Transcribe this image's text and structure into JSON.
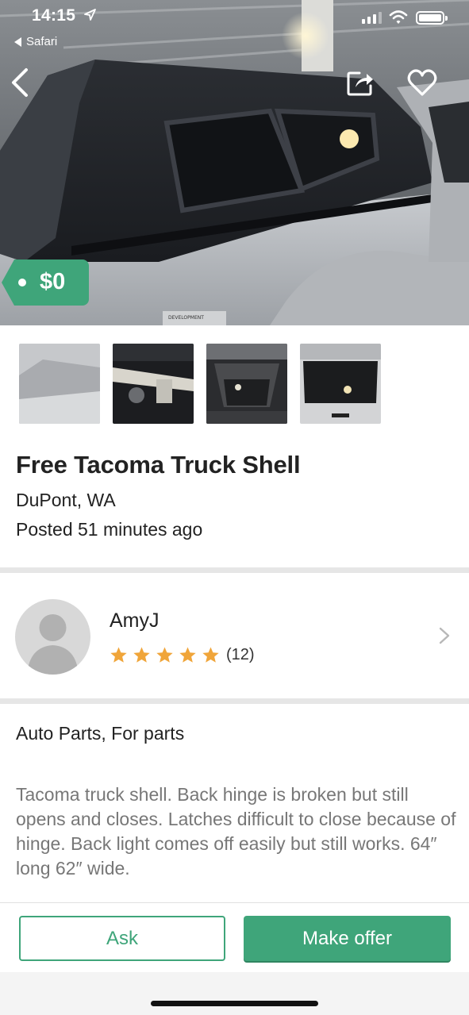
{
  "status_bar": {
    "time": "14:15",
    "back_app": "Safari"
  },
  "listing": {
    "price": "$0",
    "title": "Free Tacoma Truck Shell",
    "location": "DuPont, WA",
    "posted": "Posted 51 minutes ago",
    "category": "Auto Parts, For parts",
    "description": "Tacoma truck shell. Back hinge is broken but still opens and closes. Latches difficult to close because of hinge. Back light comes off easily but still works.  64″ long 62″ wide."
  },
  "seller": {
    "name": "AmyJ",
    "rating": 5,
    "rating_max": 5,
    "review_count": "(12)"
  },
  "actions": {
    "ask_label": "Ask",
    "offer_label": "Make offer"
  },
  "colors": {
    "accent": "#3fa57a",
    "star": "#f0a53a",
    "divider": "#e6e6e6"
  },
  "icons": [
    "location-arrow-icon",
    "signal-icon",
    "wifi-icon",
    "battery-icon",
    "back-chevron-icon",
    "share-icon",
    "heart-icon",
    "star-icon",
    "chevron-right-icon",
    "avatar-placeholder-icon"
  ]
}
